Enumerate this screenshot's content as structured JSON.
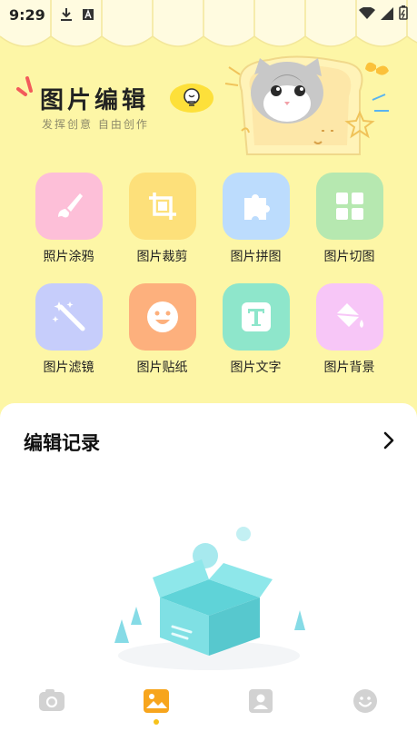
{
  "status_bar": {
    "time": "9:29"
  },
  "header": {
    "title": "图片编辑",
    "subtitle": "发挥创意 自由创作"
  },
  "tools": [
    {
      "label": "照片涂鸦",
      "icon": "brush-icon",
      "color": "#fdbfd8"
    },
    {
      "label": "图片裁剪",
      "icon": "crop-icon",
      "color": "#fde07a"
    },
    {
      "label": "图片拼图",
      "icon": "puzzle-icon",
      "color": "#bcdcfd"
    },
    {
      "label": "图片切图",
      "icon": "grid-icon",
      "color": "#b6e8b0"
    },
    {
      "label": "图片滤镜",
      "icon": "magic-wand-icon",
      "color": "#c6cdfb"
    },
    {
      "label": "图片贴纸",
      "icon": "smiley-sticker-icon",
      "color": "#fdb07d"
    },
    {
      "label": "图片文字",
      "icon": "text-icon",
      "color": "#8ee6cb"
    },
    {
      "label": "图片背景",
      "icon": "paint-bucket-icon",
      "color": "#f7c6f7"
    }
  ],
  "records": {
    "title": "编辑记录"
  },
  "bottom_nav": {
    "items": [
      {
        "icon": "camera-icon",
        "active": false
      },
      {
        "icon": "image-icon",
        "active": true
      },
      {
        "icon": "person-icon",
        "active": false
      },
      {
        "icon": "smiley-icon",
        "active": false
      }
    ],
    "active_color": "#f7a51d",
    "inactive_color": "#d2d2d2"
  }
}
